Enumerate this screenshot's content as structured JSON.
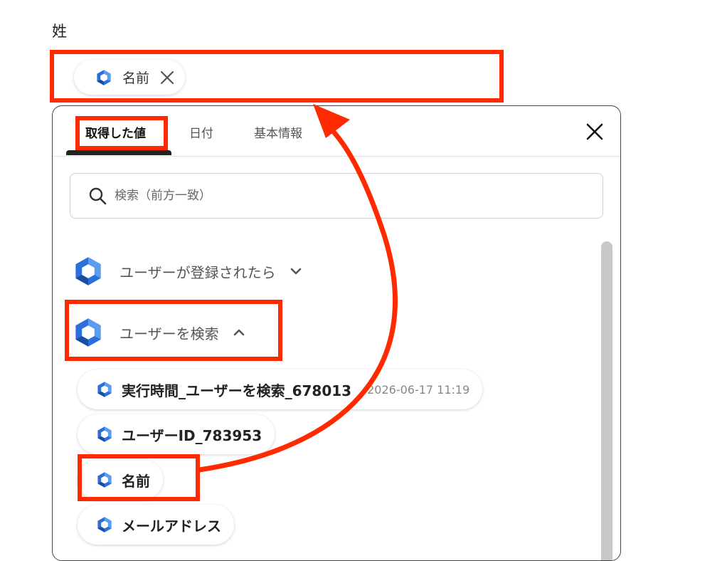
{
  "field": {
    "label": "姓",
    "chip_label": "名前"
  },
  "panel": {
    "tabs": [
      {
        "label": "取得した値"
      },
      {
        "label": "日付"
      },
      {
        "label": "基本情報"
      }
    ],
    "search_placeholder": "検索（前方一致）",
    "groups": [
      {
        "label": "ユーザーが登録されたら",
        "icon": "chevron-down-icon"
      },
      {
        "label": "ユーザーを検索",
        "icon": "chevron-up-icon"
      }
    ],
    "items": [
      {
        "label": "実行時間_ユーザーを検索_678013",
        "value": "2026-06-17 11:19"
      },
      {
        "label": "ユーザーID_783953"
      },
      {
        "label": "名前"
      },
      {
        "label": "メールアドレス"
      }
    ]
  },
  "colors": {
    "highlight": "#ff2a00",
    "brand_blue": "#2a6fdb"
  }
}
